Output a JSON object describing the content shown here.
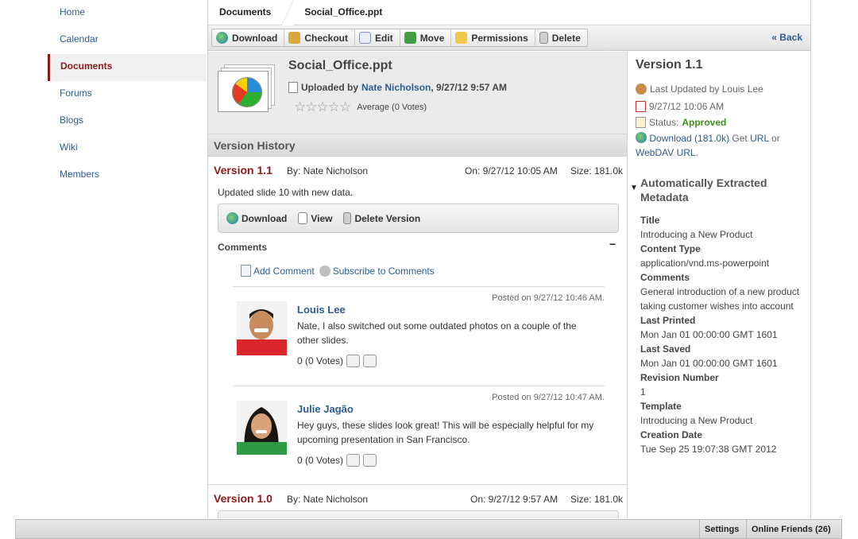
{
  "sidebar": {
    "items": [
      {
        "label": "Home"
      },
      {
        "label": "Calendar"
      },
      {
        "label": "Documents"
      },
      {
        "label": "Forums"
      },
      {
        "label": "Blogs"
      },
      {
        "label": "Wiki"
      },
      {
        "label": "Members"
      }
    ],
    "active": "Documents"
  },
  "breadcrumb": {
    "root": "Documents",
    "current": "Social_Office.ppt"
  },
  "toolbar": {
    "buttons": [
      {
        "label": "Download",
        "icon": "globe-icon"
      },
      {
        "label": "Checkout",
        "icon": "lock-icon"
      },
      {
        "label": "Edit",
        "icon": "edit-icon"
      },
      {
        "label": "Move",
        "icon": "move-icon"
      },
      {
        "label": "Permissions",
        "icon": "permissions-icon"
      },
      {
        "label": "Delete",
        "icon": "trash-icon"
      }
    ],
    "back": "« Back"
  },
  "file": {
    "title": "Social_Office.ppt",
    "uploaded_prefix": "Uploaded by",
    "uploader": "Nate Nicholson",
    "uploaded_date": ", 9/27/12 9:57 AM",
    "rating_text": "Average (0 Votes)",
    "stars": 0
  },
  "version_history": {
    "title": "Version History",
    "versions": [
      {
        "label": "Version 1.1",
        "by": "By: Nate Nicholson",
        "on": "On: 9/27/12 10:05 AM",
        "size": "Size: 181.0k",
        "description": "Updated slide 10 with new data.",
        "actions": [
          "Download",
          "View",
          "Delete Version"
        ]
      },
      {
        "label": "Version 1.0",
        "by": "By: Nate Nicholson",
        "on": "On: 9/27/12 9:57 AM",
        "size": "Size: 181.0k"
      }
    ]
  },
  "comments": {
    "label": "Comments",
    "collapse": "−",
    "add": "Add Comment",
    "subscribe": "Subscribe to Comments",
    "items": [
      {
        "posted": "Posted on 9/27/12 10:46 AM.",
        "author": "Louis Lee",
        "text": "Nate, I also switched out some outdated photos on a couple of the other slides.",
        "votes": "0 (0 Votes)"
      },
      {
        "posted": "Posted on 9/27/12 10:47 AM.",
        "author": "Julie Jagão",
        "text": "Hey guys, these slides look great! This will be especially helpful for my upcoming presentation in San Francisco.",
        "votes": "0 (0 Votes)"
      }
    ]
  },
  "details": {
    "version_title": "Version 1.1",
    "last_updated": "Last Updated by Louis Lee",
    "date": "9/27/12 10:06 AM",
    "status_label": "Status:",
    "status_value": "Approved",
    "download_link": "Download (181.0k)",
    "get_text": "Get",
    "url_link": "URL",
    "or_text": "or",
    "webdav_link": "WebDAV URL",
    "period": "."
  },
  "metadata": {
    "title": "Automatically Extracted Metadata",
    "fields": [
      {
        "key": "Title",
        "value": "Introducing a New Product"
      },
      {
        "key": "Content Type",
        "value": "application/vnd.ms-powerpoint"
      },
      {
        "key": "Comments",
        "value": "General introduction of a new product taking customer wishes into account"
      },
      {
        "key": "Last Printed",
        "value": "Mon Jan 01 00:00:00 GMT 1601"
      },
      {
        "key": "Last Saved",
        "value": "Mon Jan 01 00:00:00 GMT 1601"
      },
      {
        "key": "Revision Number",
        "value": "1"
      },
      {
        "key": "Template",
        "value": "Introducing a New Product"
      },
      {
        "key": "Creation Date",
        "value": "Tue Sep 25 19:07:38 GMT 2012"
      }
    ]
  },
  "dock": {
    "settings": "Settings",
    "online_friends": "Online Friends (26)"
  },
  "colors": {
    "link": "#2c5c90",
    "accent": "#8b1a1a",
    "approved": "#3e8e1e"
  }
}
